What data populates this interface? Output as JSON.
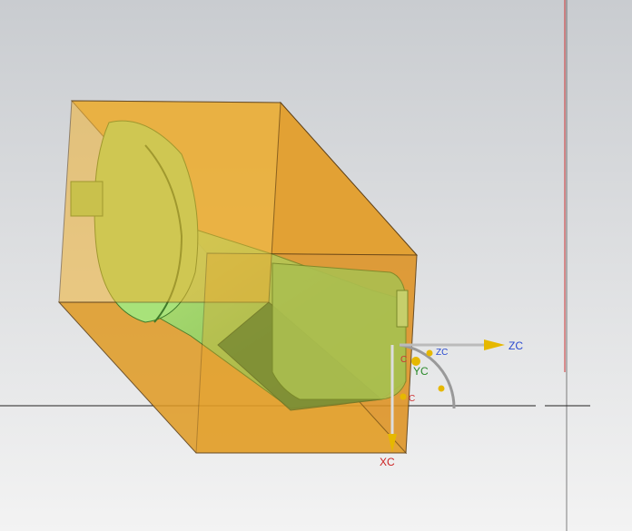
{
  "viewport": {
    "background_top": "#cfd2d6",
    "background_bottom": "#f2f2f2"
  },
  "colors": {
    "bounding_box": "#e8a526",
    "part": "#8fd66a",
    "axis_x": "#cc2222",
    "axis_y": "#2a8a2a",
    "axis_z": "#2a4ad0",
    "handle": "#e6b800"
  },
  "csys": {
    "zc_label": "ZC",
    "zc_small_label": "ZC",
    "yc_label": "YC",
    "xc_label": "XC",
    "c_label": "C"
  }
}
